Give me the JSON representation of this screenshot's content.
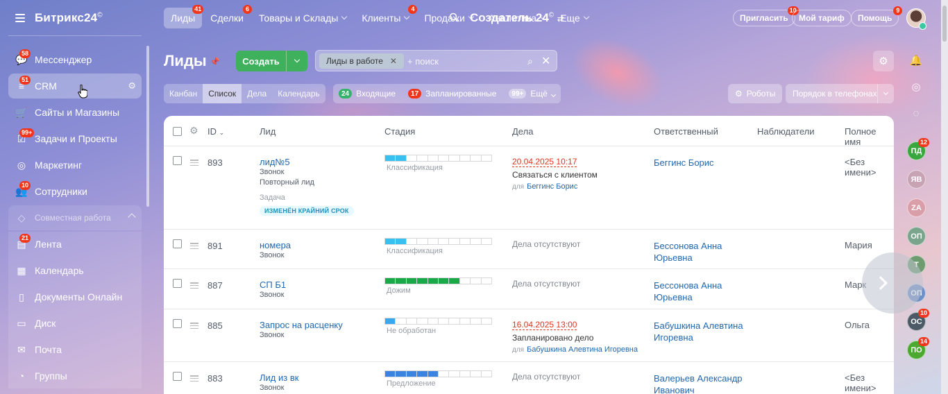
{
  "app": {
    "brand": "Битрикс24",
    "brand_mark": "©",
    "company": "Создатель 24",
    "company_mark": "©"
  },
  "sidebar": {
    "items": [
      {
        "label": "Мессенджер",
        "badge": "58",
        "icon": "chat-icon"
      },
      {
        "label": "CRM",
        "badge": "51",
        "icon": "filter-icon",
        "active": true
      },
      {
        "label": "Сайты и Магазины",
        "badge": "",
        "icon": "cart-icon"
      },
      {
        "label": "Задачи и Проекты",
        "badge": "99+",
        "icon": "tasks-icon"
      },
      {
        "label": "Маркетинг",
        "badge": "",
        "icon": "target-icon"
      },
      {
        "label": "Сотрудники",
        "badge": "10",
        "icon": "people-icon"
      }
    ],
    "section": {
      "label": "Совместная работа"
    },
    "group_items": [
      {
        "label": "Лента",
        "badge": "21",
        "icon": "feed-icon"
      },
      {
        "label": "Календарь",
        "badge": "",
        "icon": "calendar-icon"
      },
      {
        "label": "Документы Онлайн",
        "badge": "",
        "icon": "document-icon"
      },
      {
        "label": "Диск",
        "badge": "",
        "icon": "disk-icon"
      },
      {
        "label": "Почта",
        "badge": "",
        "icon": "mail-icon"
      },
      {
        "label": "Группы",
        "badge": "",
        "icon": "groups-icon"
      }
    ]
  },
  "topnav": {
    "items": [
      {
        "label": "Лиды",
        "badge": "41",
        "active": true,
        "dropdown": false
      },
      {
        "label": "Сделки",
        "badge": "6",
        "dropdown": false
      },
      {
        "label": "Товары и Склады",
        "badge": "",
        "dropdown": true
      },
      {
        "label": "Клиенты",
        "badge": "4",
        "dropdown": true
      },
      {
        "label": "Продажи",
        "badge": "",
        "dropdown": true
      },
      {
        "label": "Аналитика",
        "badge": "",
        "dropdown": true
      },
      {
        "label": "Еще",
        "badge": "",
        "dropdown": true
      }
    ],
    "invite": {
      "label": "Пригласить",
      "badge": "10"
    },
    "tariff": {
      "label": "Мой тариф"
    },
    "help": {
      "label": "Помощь",
      "badge": "9"
    }
  },
  "page": {
    "title": "Лиды",
    "create_label": "Создать",
    "filter_tag": "Лиды в работе",
    "search_placeholder": "+ поиск"
  },
  "view_tabs": [
    {
      "label": "Канбан"
    },
    {
      "label": "Список",
      "active": true
    },
    {
      "label": "Дела"
    },
    {
      "label": "Календарь"
    }
  ],
  "counters": {
    "incoming": {
      "count": "24",
      "label": "Входящие"
    },
    "planned": {
      "count": "17",
      "label": "Запланированные"
    },
    "more": {
      "count": "99+",
      "label": "Ещё"
    }
  },
  "toolbar_right": {
    "robots": "Роботы",
    "order": "Порядок в телефонах"
  },
  "table": {
    "columns": [
      "ID",
      "Лид",
      "Стадия",
      "Дела",
      "Ответственный",
      "Наблюдатели",
      "Полное имя"
    ],
    "rows": [
      {
        "id": "893",
        "lead": "лид№5",
        "source": "Звонок",
        "extra": "Повторный лид",
        "task_label": "Задача",
        "task_tag": "ИЗМЕНЁН КРАЙНИЙ СРОК",
        "stage": "Классификация",
        "stage_color": "#39c0f0",
        "stage_fill": 2,
        "deal_date": "20.04.2025 10:17",
        "deal_title": "Связаться с клиентом",
        "deal_for_label": "для",
        "deal_for": "Беггинс Борис",
        "responsible": "Беггинс Борис",
        "fullname": "<Без имени>"
      },
      {
        "id": "891",
        "lead": "номера",
        "source": "Звонок",
        "stage": "Классификация",
        "stage_color": "#39c0f0",
        "stage_fill": 2,
        "deal_none": "Дела отсутствуют",
        "responsible": "Бессонова Анна Юрьевна",
        "fullname": "Мария"
      },
      {
        "id": "887",
        "lead": "СП Б1",
        "source": "Звонок",
        "stage": "Дожим",
        "stage_color": "#19a948",
        "stage_fill": 7,
        "deal_none": "Дела отсутствуют",
        "responsible": "Бессонова Анна Юрьевна",
        "fullname": "Марк"
      },
      {
        "id": "885",
        "lead": "Запрос на расценку",
        "source": "Звонок",
        "stage": "Не обработан",
        "stage_color": "#39a8ef",
        "stage_fill": 1,
        "deal_date": "16.04.2025 13:00",
        "deal_title": "Запланировано дело",
        "deal_for_label": "для",
        "deal_for": "Бабушкина Алевтина Игоревна",
        "responsible": "Бабушкина Алевтина Игоревна",
        "fullname": "Ольга"
      },
      {
        "id": "883",
        "lead": "Лид из вк",
        "source": "Звонок",
        "stage": "Предложение",
        "stage_color": "#3a83e0",
        "stage_fill": 5,
        "deal_none": "Дела отсутствуют",
        "responsible": "Валерьев Александр Иванович",
        "fullname": "<Без имени>"
      }
    ]
  },
  "right_rail": {
    "icons": [
      "bell-icon",
      "spiral-icon",
      "chat-bubble-icon"
    ],
    "avatars": [
      {
        "initials": "ПД",
        "color": "#3aa63e",
        "badge": "12"
      },
      {
        "initials": "ЯВ",
        "color": "#c8a3b4",
        "badge": ""
      },
      {
        "initials": "ZA",
        "color": "#d99ea8",
        "badge": ""
      },
      {
        "initials": "ОП",
        "color": "#7aa48c",
        "badge": ""
      },
      {
        "initials": "Т",
        "color": "#6e9b6f",
        "badge": ""
      },
      {
        "initials": "ОП",
        "color": "#6f8fc7",
        "badge": ""
      },
      {
        "initials": "ОС",
        "color": "#4c5a66",
        "badge": "10"
      },
      {
        "initials": "ПО",
        "color": "#4aa92e",
        "badge": "14"
      }
    ]
  }
}
